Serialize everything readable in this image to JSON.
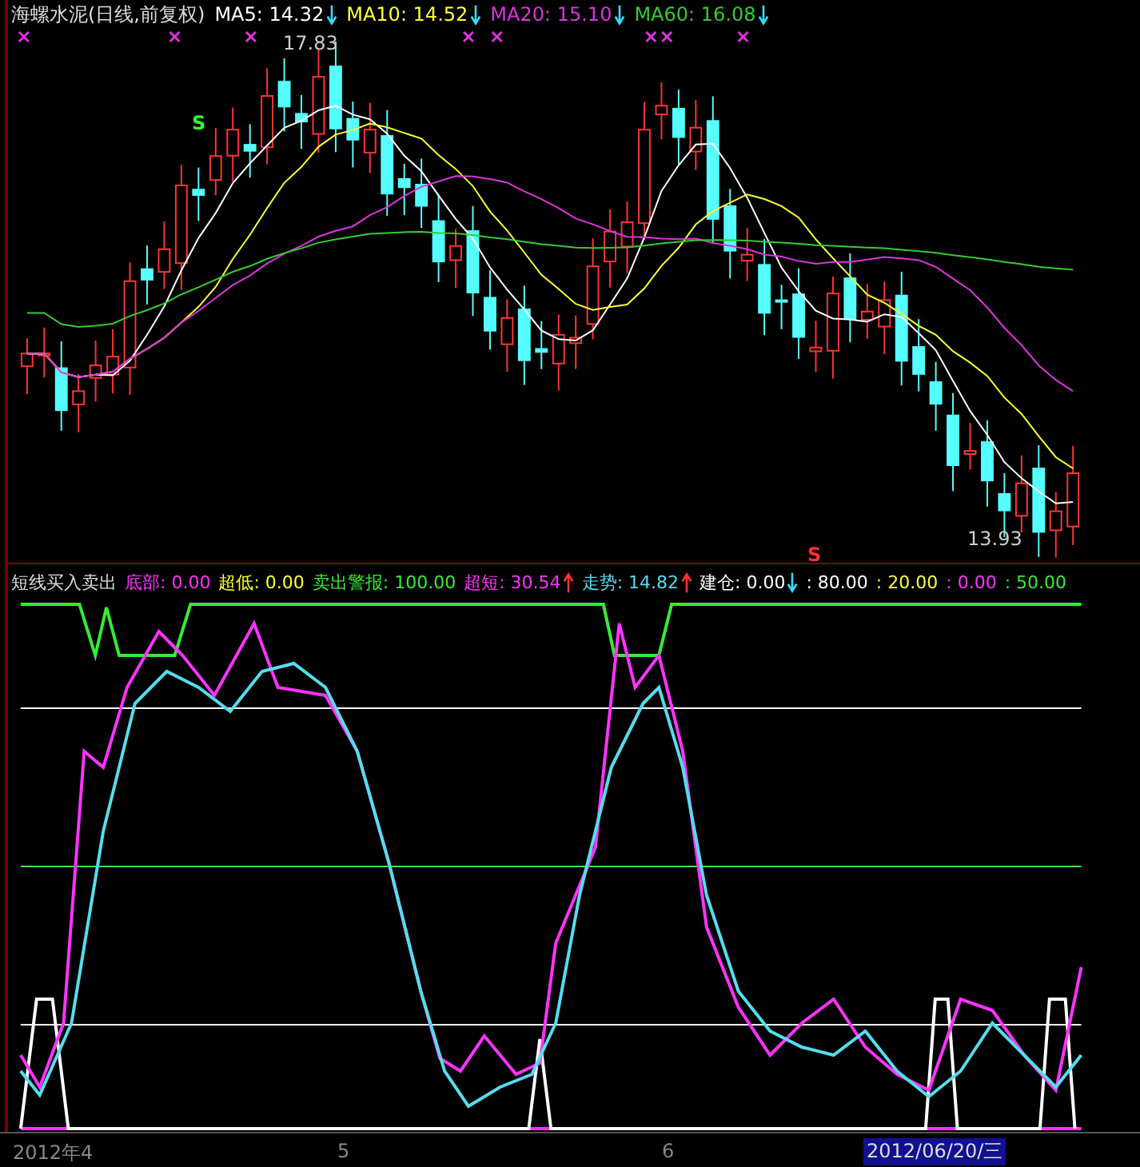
{
  "main_chart": {
    "title": "海螺水泥(日线,前复权)",
    "legend": [
      {
        "label": "MA5: 14.32",
        "color": "#ffffff",
        "rising": false
      },
      {
        "label": "MA10: 14.52",
        "color": "#ffff33",
        "rising": false
      },
      {
        "label": "MA20: 15.10",
        "color": "#dd33dd",
        "rising": false
      },
      {
        "label": "MA60: 16.08",
        "color": "#33cc33",
        "rising": false
      }
    ],
    "high_label": "17.83",
    "low_label": "13.93",
    "signals": [
      {
        "label": "S",
        "color": "#33ff33"
      },
      {
        "label": "S",
        "color": "#ff3333"
      }
    ]
  },
  "indicator": {
    "title": "短线买入卖出",
    "legend": [
      {
        "label": "底部: 0.00",
        "color": "#ff33ff"
      },
      {
        "label": "超低: 0.00",
        "color": "#ffff33"
      },
      {
        "label": "卖出警报: 100.00",
        "color": "#33ee33"
      },
      {
        "label": "超短: 30.54",
        "color": "#ff33ff",
        "rising": true
      },
      {
        "label": "走势: 14.82",
        "color": "#55ddee",
        "rising": true
      },
      {
        "label": "建仓: 0.00",
        "color": "#ffffff",
        "rising": false
      },
      {
        "label": ": 80.00",
        "color": "#ffffff"
      },
      {
        "label": ": 20.00",
        "color": "#ffff33"
      },
      {
        "label": ": 0.00",
        "color": "#ff33ff"
      },
      {
        "label": ": 50.00",
        "color": "#33ee33"
      }
    ]
  },
  "time_axis": {
    "labels": [
      "2012年4",
      "5",
      "6"
    ],
    "cursor_date": "2012/06/20/三"
  }
}
